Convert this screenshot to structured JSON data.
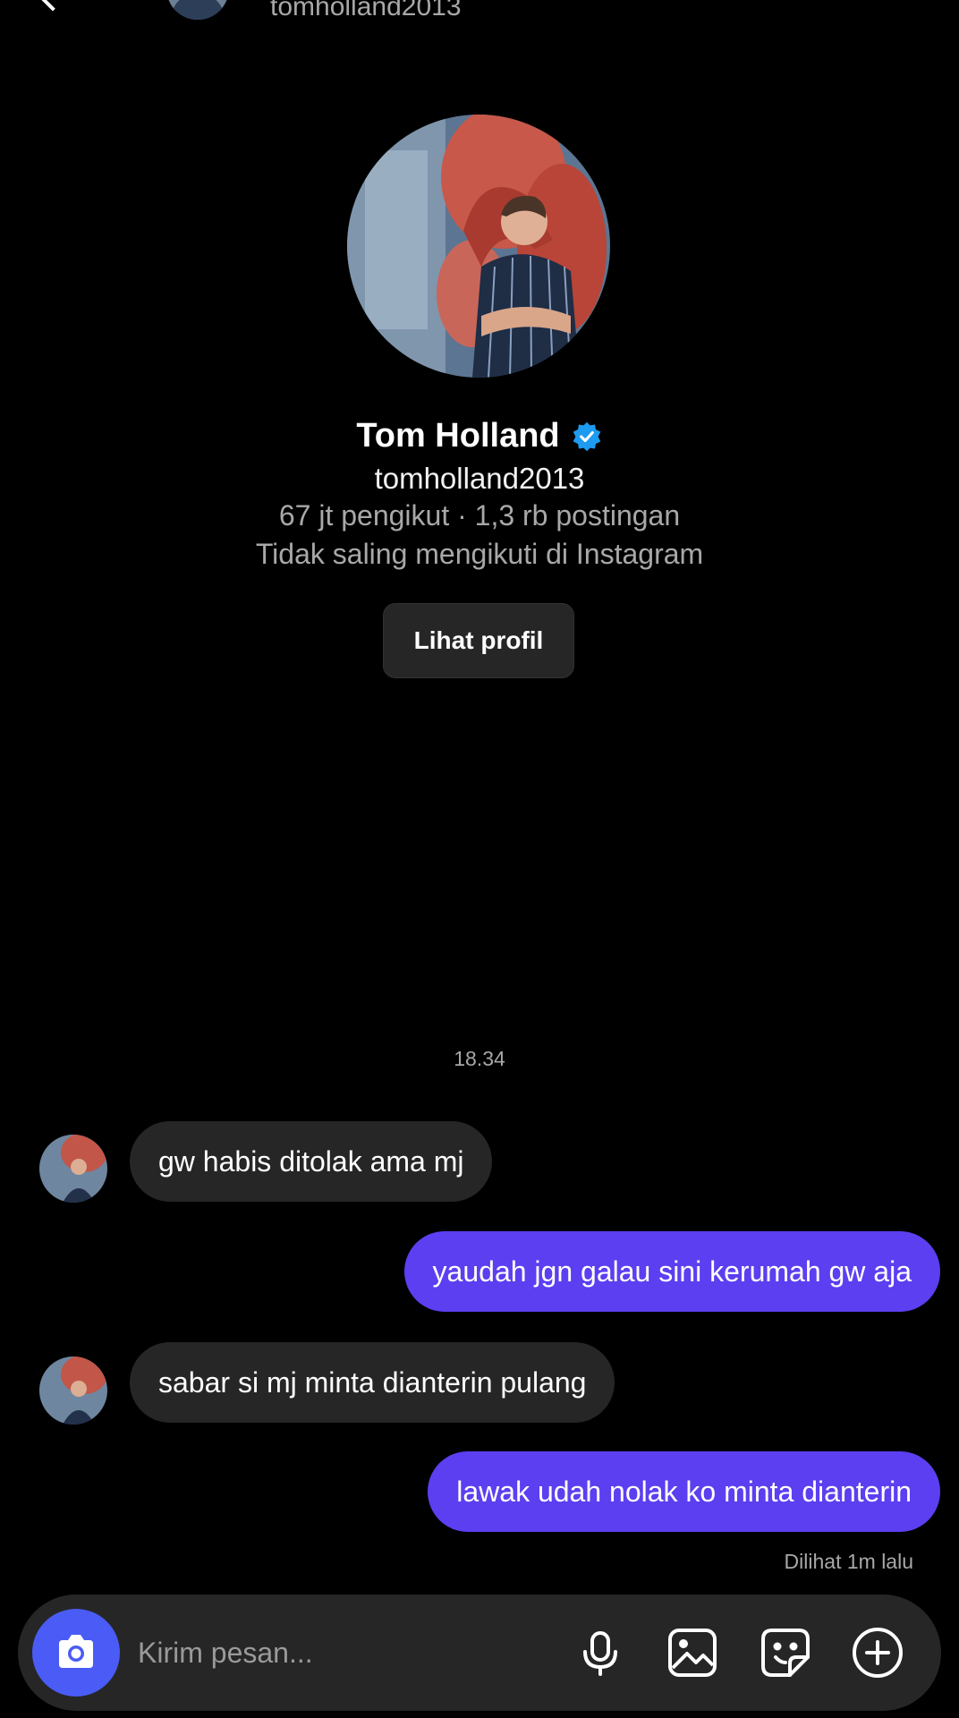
{
  "header": {
    "username": "tomholland2013"
  },
  "profile": {
    "display_name": "Tom Holland",
    "username": "tomholland2013",
    "stats": "67 jt pengikut · 1,3 rb postingan",
    "follow_status": "Tidak saling mengikuti di Instagram",
    "view_profile_label": "Lihat profil"
  },
  "conversation": {
    "timestamp": "18.34",
    "messages": [
      {
        "direction": "incoming",
        "text": "gw habis ditolak ama mj"
      },
      {
        "direction": "outgoing",
        "text": "yaudah jgn galau sini kerumah gw aja"
      },
      {
        "direction": "incoming",
        "text": "sabar si mj minta dianterin pulang"
      },
      {
        "direction": "outgoing",
        "text": "lawak udah nolak ko minta dianterin"
      }
    ],
    "seen_status": "Dilihat 1m lalu"
  },
  "composer": {
    "placeholder": "Kirim pesan...",
    "icons": [
      "camera-icon",
      "microphone-icon",
      "gallery-icon",
      "sticker-icon",
      "plus-icon"
    ]
  },
  "colors": {
    "background": "#000000",
    "incoming_bubble": "#262626",
    "outgoing_bubble": "#5b3ff0",
    "camera_button": "#4a5cf5",
    "verified": "#1d9bf0"
  }
}
